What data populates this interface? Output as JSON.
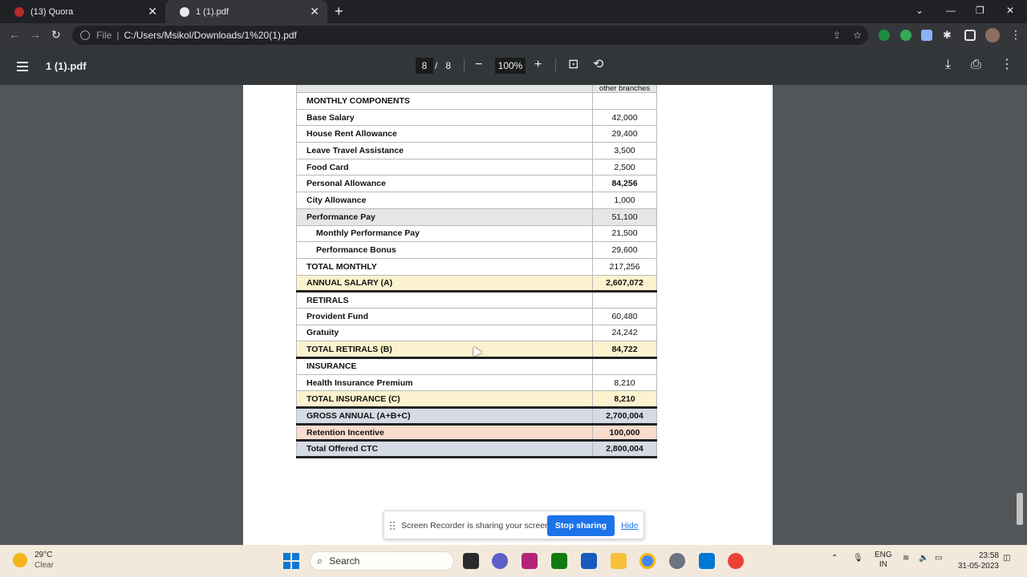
{
  "browser": {
    "tabs": [
      {
        "title": "(13) Quora",
        "active": false
      },
      {
        "title": "1 (1).pdf",
        "active": true
      }
    ],
    "address": {
      "scheme_label": "File",
      "separator": "|",
      "url": "C:/Users/Msikol/Downloads/1%20(1).pdf"
    }
  },
  "pdf_viewer": {
    "doc_name": "1 (1).pdf",
    "current_page": "8",
    "page_sep": "/",
    "total_pages": "8",
    "zoom": "100%"
  },
  "table": {
    "header_partial": "other branches",
    "rows": [
      {
        "label": "MONTHLY COMPONENTS",
        "value": "",
        "style": "plain"
      },
      {
        "label": "Base Salary",
        "value": "42,000",
        "style": "plain"
      },
      {
        "label": "House Rent Allowance",
        "value": "29,400",
        "style": "plain"
      },
      {
        "label": "Leave Travel Assistance",
        "value": "3,500",
        "style": "plain"
      },
      {
        "label": "Food Card",
        "value": "2,500",
        "style": "plain"
      },
      {
        "label": "Personal Allowance",
        "value": "84,256",
        "style": "plain",
        "bold_value": true
      },
      {
        "label": "City Allowance",
        "value": "1,000",
        "style": "plain"
      },
      {
        "label": "Performance Pay",
        "value": "51,100",
        "style": "gray"
      },
      {
        "label": "Monthly Performance Pay",
        "value": "21,500",
        "style": "indent"
      },
      {
        "label": "Performance Bonus",
        "value": "29,600",
        "style": "indent"
      },
      {
        "label": "TOTAL MONTHLY",
        "value": "217,256",
        "style": "plain"
      },
      {
        "label": "ANNUAL SALARY (A)",
        "value": "2,607,072",
        "style": "yellow",
        "bold_value": true
      },
      {
        "label": "RETIRALS",
        "value": "",
        "style": "plain"
      },
      {
        "label": "Provident Fund",
        "value": "60,480",
        "style": "plain"
      },
      {
        "label": "Gratuity",
        "value": "24,242",
        "style": "plain"
      },
      {
        "label": "TOTAL RETIRALS (B)",
        "value": "84,722",
        "style": "yellow",
        "bold_value": true
      },
      {
        "label": "INSURANCE",
        "value": "",
        "style": "plain"
      },
      {
        "label": "Health Insurance Premium",
        "value": "8,210",
        "style": "plain"
      },
      {
        "label": "TOTAL INSURANCE (C)",
        "value": "8,210",
        "style": "yellow",
        "bold_value": true
      },
      {
        "label": "GROSS ANNUAL (A+B+C)",
        "value": "2,700,004",
        "style": "blue",
        "bold_value": true
      },
      {
        "label": "Retention Incentive",
        "value": "100,000",
        "style": "pink",
        "bold_value": true
      },
      {
        "label": "Total Offered CTC",
        "value": "2,800,004",
        "style": "blue",
        "bold_value": true
      }
    ]
  },
  "share_banner": {
    "message": "Screen Recorder is sharing your screen.",
    "stop_label": "Stop sharing",
    "hide_label": "Hide"
  },
  "taskbar": {
    "weather_temp": "29°C",
    "weather_desc": "Clear",
    "search_label": "Search",
    "lang_1": "ENG",
    "lang_2": "IN",
    "time": "23:58",
    "date": "31-05-2023"
  },
  "colors": {
    "yellow_row": "#fdf2cf",
    "blue_row": "#d5dbe4",
    "pink_row": "#f8dccd",
    "gray_row": "#e6e6e6",
    "stop_button": "#1a73e8"
  }
}
